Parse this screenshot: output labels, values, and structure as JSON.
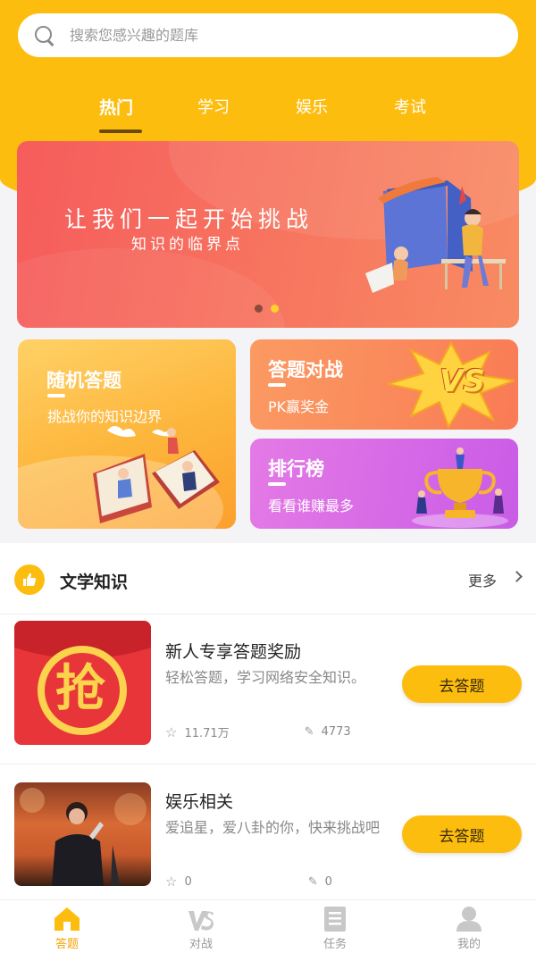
{
  "search": {
    "placeholder": "搜索您感兴趣的题库"
  },
  "tabs": [
    {
      "label": "热门",
      "active": true
    },
    {
      "label": "学习",
      "active": false
    },
    {
      "label": "娱乐",
      "active": false
    },
    {
      "label": "考试",
      "active": false
    }
  ],
  "banner": {
    "title": "让我们一起开始挑战",
    "subtitle": "知识的临界点",
    "slide_count": 2,
    "active_slide": 2
  },
  "cards": {
    "random": {
      "title": "随机答题",
      "subtitle": "挑战你的知识边界"
    },
    "pk": {
      "title": "答题对战",
      "subtitle": "PK赢奖金",
      "badge": "VS"
    },
    "rank": {
      "title": "排行榜",
      "subtitle": "看看谁赚最多"
    }
  },
  "section": {
    "title": "文学知识",
    "more_label": "更多"
  },
  "items": [
    {
      "title": "新人专享答题奖励",
      "description": "轻松答题，学习网络安全知识。",
      "stars": "11.71万",
      "edits": "4773",
      "button": "去答题",
      "thumb_glyph": "抢"
    },
    {
      "title": "娱乐相关",
      "description": "爱追星，爱八卦的你，快来挑战吧",
      "stars": "0",
      "edits": "0",
      "button": "去答题"
    }
  ],
  "nav": [
    {
      "label": "答题",
      "icon": "home-icon",
      "active": true
    },
    {
      "label": "对战",
      "icon": "vs-icon",
      "active": false
    },
    {
      "label": "任务",
      "icon": "task-icon",
      "active": false
    },
    {
      "label": "我的",
      "icon": "user-icon",
      "active": false
    }
  ],
  "colors": {
    "brand": "#fdbd0f",
    "active_nav": "#f5a30a",
    "banner": "#f65c5c"
  }
}
